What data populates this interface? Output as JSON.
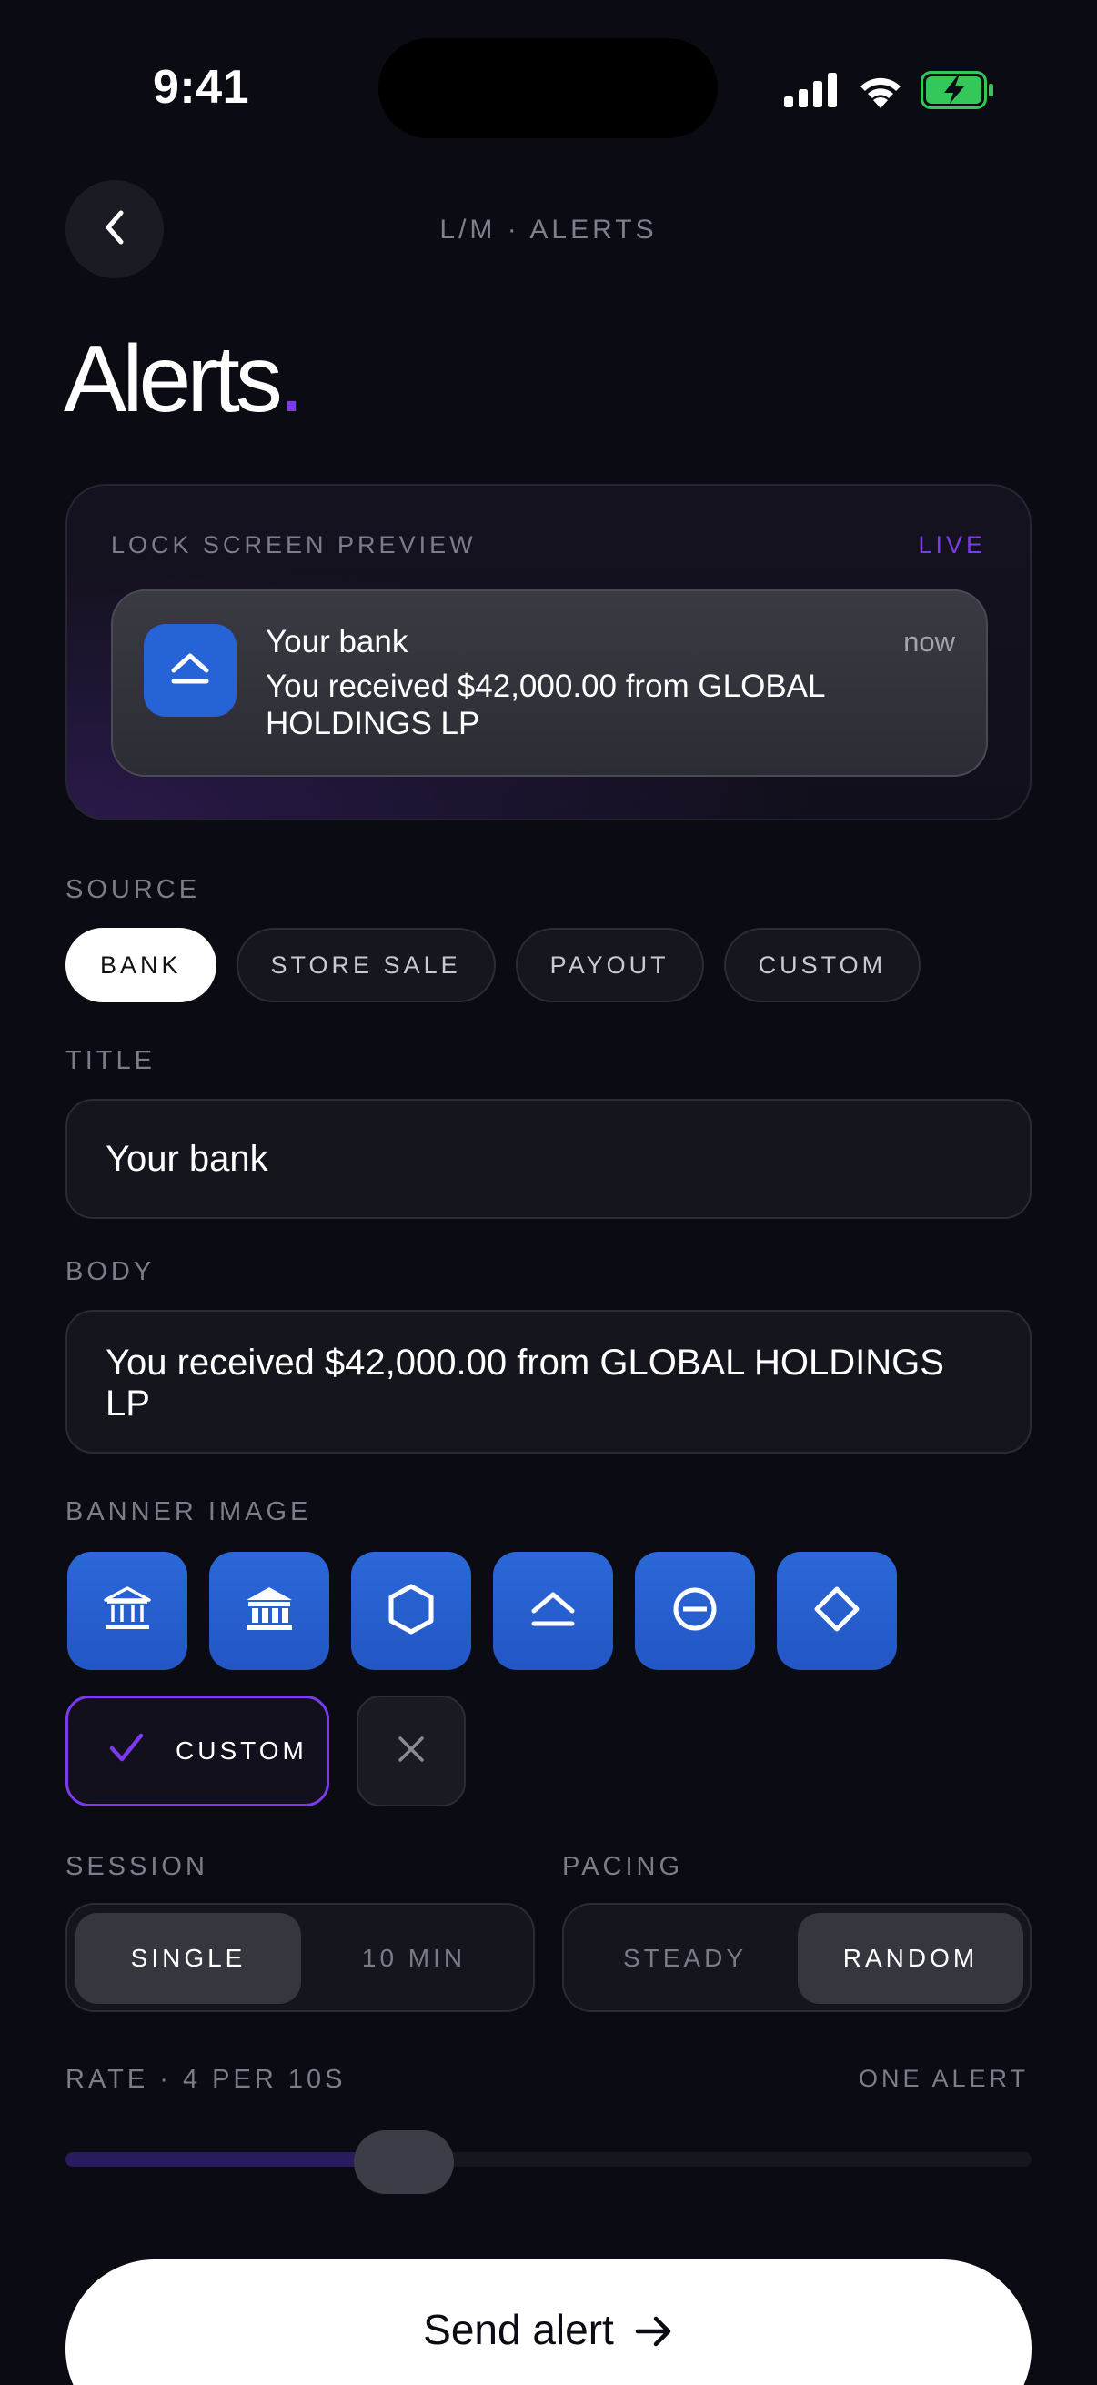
{
  "status_bar": {
    "time": "9:41",
    "battery_color": "#34c759"
  },
  "header": {
    "nav_title": "L/M · ALERTS",
    "title": "Alerts",
    "title_dot": ".",
    "accent": "#7c3aed"
  },
  "preview": {
    "label": "LOCK SCREEN PREVIEW",
    "live": "LIVE",
    "notification": {
      "title": "Your bank",
      "time": "now",
      "body": "You received $42,000.00 from GLOBAL HOLDINGS LP",
      "icon": "eject-icon"
    }
  },
  "source": {
    "label": "SOURCE",
    "options": [
      "BANK",
      "STORE SALE",
      "PAYOUT",
      "CUSTOM"
    ],
    "selected": "BANK"
  },
  "title_field": {
    "label": "TITLE",
    "value": "Your bank"
  },
  "body_field": {
    "label": "BODY",
    "value": "You received $42,000.00 from GLOBAL HOLDINGS LP"
  },
  "banner": {
    "label": "BANNER IMAGE",
    "icons": [
      "bank-icon",
      "bank-bold-icon",
      "hexagon-icon",
      "eject-icon",
      "minus-circle-icon",
      "diamond-icon"
    ],
    "custom_label": "CUSTOM",
    "icon_color": "#2563d6"
  },
  "session": {
    "label": "SESSION",
    "options": [
      "SINGLE",
      "10 MIN"
    ],
    "selected": "SINGLE"
  },
  "pacing": {
    "label": "PACING",
    "options": [
      "STEADY",
      "RANDOM"
    ],
    "selected": "RANDOM"
  },
  "rate": {
    "label": "RATE · 4 PER 10S",
    "right_label": "ONE ALERT",
    "slider_value": 0.35
  },
  "send": {
    "label": "Send alert"
  }
}
